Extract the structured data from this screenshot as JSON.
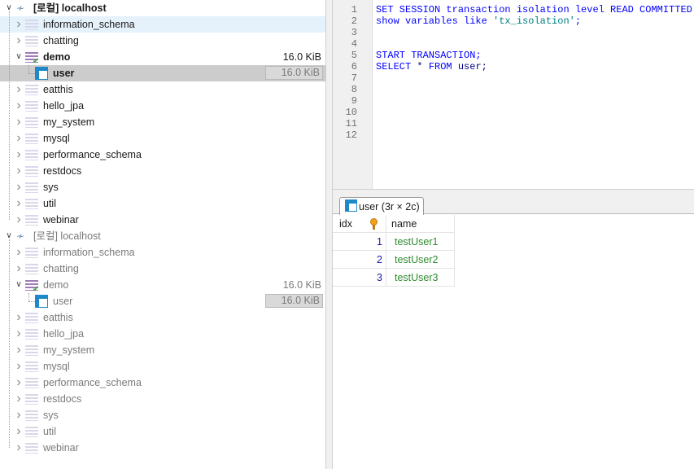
{
  "tree": {
    "servers": [
      {
        "name": "[로컬] localhost",
        "active": true,
        "databases": [
          "information_schema",
          "chatting",
          "demo",
          "eatthis",
          "hello_jpa",
          "my_system",
          "mysql",
          "performance_schema",
          "restdocs",
          "sys",
          "util",
          "webinar"
        ],
        "expanded_db": {
          "name": "demo",
          "size": "16.0 KiB"
        },
        "table": {
          "name": "user",
          "size": "16.0 KiB"
        }
      },
      {
        "name": "[로컬] localhost",
        "active": false,
        "databases": [
          "information_schema",
          "chatting",
          "demo",
          "eatthis",
          "hello_jpa",
          "my_system",
          "mysql",
          "performance_schema",
          "restdocs",
          "sys",
          "util",
          "webinar"
        ],
        "expanded_db": {
          "name": "demo",
          "size": "16.0 KiB"
        },
        "table": {
          "name": "user",
          "size": "16.0 KiB"
        }
      }
    ]
  },
  "editor": {
    "line_numbers": [
      "1",
      "2",
      "3",
      "4",
      "5",
      "6",
      "7",
      "8",
      "9",
      "10",
      "11",
      "12"
    ],
    "lines": [
      [
        {
          "t": "SET SESSION transaction isolation level READ COMMITTED;",
          "c": "kw"
        }
      ],
      [
        {
          "t": "show variables like ",
          "c": "kw"
        },
        {
          "t": "'tx_isolation'",
          "c": "str"
        },
        {
          "t": ";",
          "c": "kw"
        }
      ],
      [],
      [],
      [
        {
          "t": "START TRANSACTION;",
          "c": "kw"
        }
      ],
      [
        {
          "t": "SELECT ",
          "c": "kw"
        },
        {
          "t": "*",
          "c": "op"
        },
        {
          "t": " FROM ",
          "c": "kw"
        },
        {
          "t": "user;",
          "c": "op"
        }
      ],
      [],
      [],
      [],
      [],
      [],
      []
    ]
  },
  "result": {
    "tab_label": "user (3r × 2c)",
    "columns": [
      "idx",
      "name"
    ],
    "key_icon": "primary-key-icon",
    "rows": [
      [
        "1",
        "testUser1"
      ],
      [
        "2",
        "testUser2"
      ],
      [
        "3",
        "testUser3"
      ]
    ]
  },
  "colors": {
    "keyword": "#0000ff",
    "string": "#008080",
    "number": "#1a1aa8",
    "text_value": "#2e8b2e",
    "hover_row": "#e5f1fb",
    "selected_row": "#cccccc"
  }
}
